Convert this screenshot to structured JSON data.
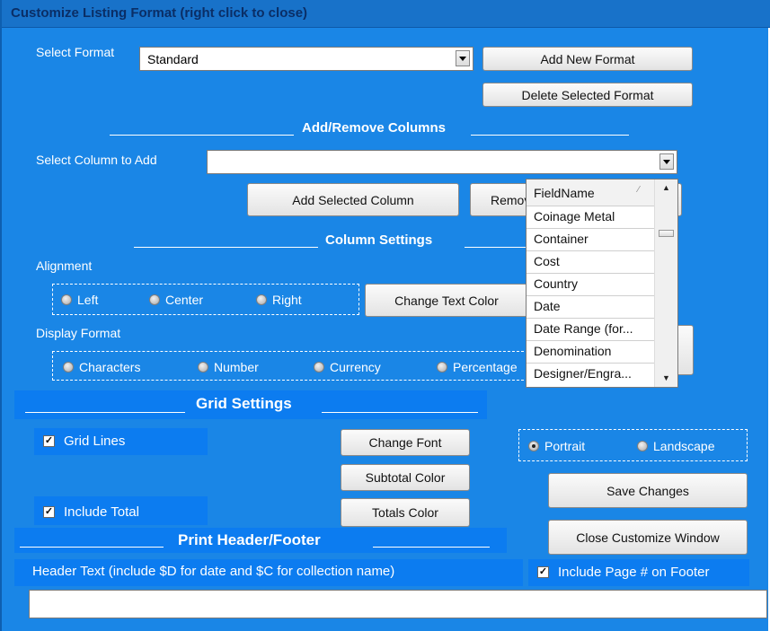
{
  "window": {
    "title": "Customize Listing Format (right click to close)"
  },
  "format": {
    "label": "Select Format",
    "selected": "Standard",
    "add_button": "Add New Format",
    "delete_button": "Delete Selected Format"
  },
  "add_remove": {
    "heading": "Add/Remove Columns",
    "select_label": "Select Column to Add",
    "selected": "",
    "add_button": "Add Selected Column",
    "remove_button": "Remove"
  },
  "dropdown": {
    "header": "FieldName",
    "items": [
      "Coinage Metal",
      "Container",
      "Cost",
      "Country",
      "Date",
      "Date Range (for...",
      "Denomination",
      "Designer/Engra..."
    ]
  },
  "column_settings": {
    "heading": "Column Settings",
    "alignment_label": "Alignment",
    "alignment_options": [
      "Left",
      "Center",
      "Right"
    ],
    "change_text_color": "Change Text Color",
    "display_format_label": "Display Format",
    "display_options": [
      "Characters",
      "Number",
      "Currency",
      "Percentage"
    ]
  },
  "grid_settings": {
    "heading": "Grid Settings",
    "grid_lines": "Grid Lines",
    "include_total": "Include Total",
    "change_font": "Change Font",
    "subtotal_color": "Subtotal Color",
    "totals_color": "Totals Color",
    "orientation": [
      "Portrait",
      "Landscape"
    ],
    "orientation_selected": "Portrait",
    "save_button": "Save Changes",
    "close_button": "Close Customize Window"
  },
  "print": {
    "heading": "Print Header/Footer",
    "header_label": "Header Text (include $D for date and $C for collection name)",
    "include_page": "Include Page # on Footer",
    "header_value": ""
  }
}
